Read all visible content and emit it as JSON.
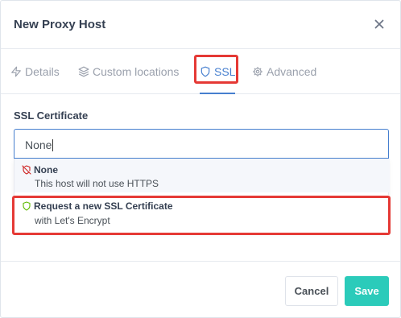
{
  "modal": {
    "title": "New Proxy Host"
  },
  "tabs": [
    {
      "label": "Details",
      "icon": "zap-icon"
    },
    {
      "label": "Custom locations",
      "icon": "layers-icon"
    },
    {
      "label": "SSL",
      "icon": "shield-icon",
      "active": true
    },
    {
      "label": "Advanced",
      "icon": "gear-icon"
    }
  ],
  "ssl": {
    "label": "SSL Certificate",
    "select_value": "None",
    "options": [
      {
        "title": "None",
        "description": "This host will not use HTTPS",
        "icon": "shield-off-icon",
        "icon_color": "#cd201f"
      },
      {
        "title": "Request a new SSL Certificate",
        "description": "with Let's Encrypt",
        "icon": "shield-icon",
        "icon_color": "#5eba00"
      }
    ]
  },
  "footer": {
    "cancel_label": "Cancel",
    "save_label": "Save"
  },
  "colors": {
    "accent": "#467fcf",
    "save": "#2bcbba",
    "highlight": "#e53935"
  }
}
